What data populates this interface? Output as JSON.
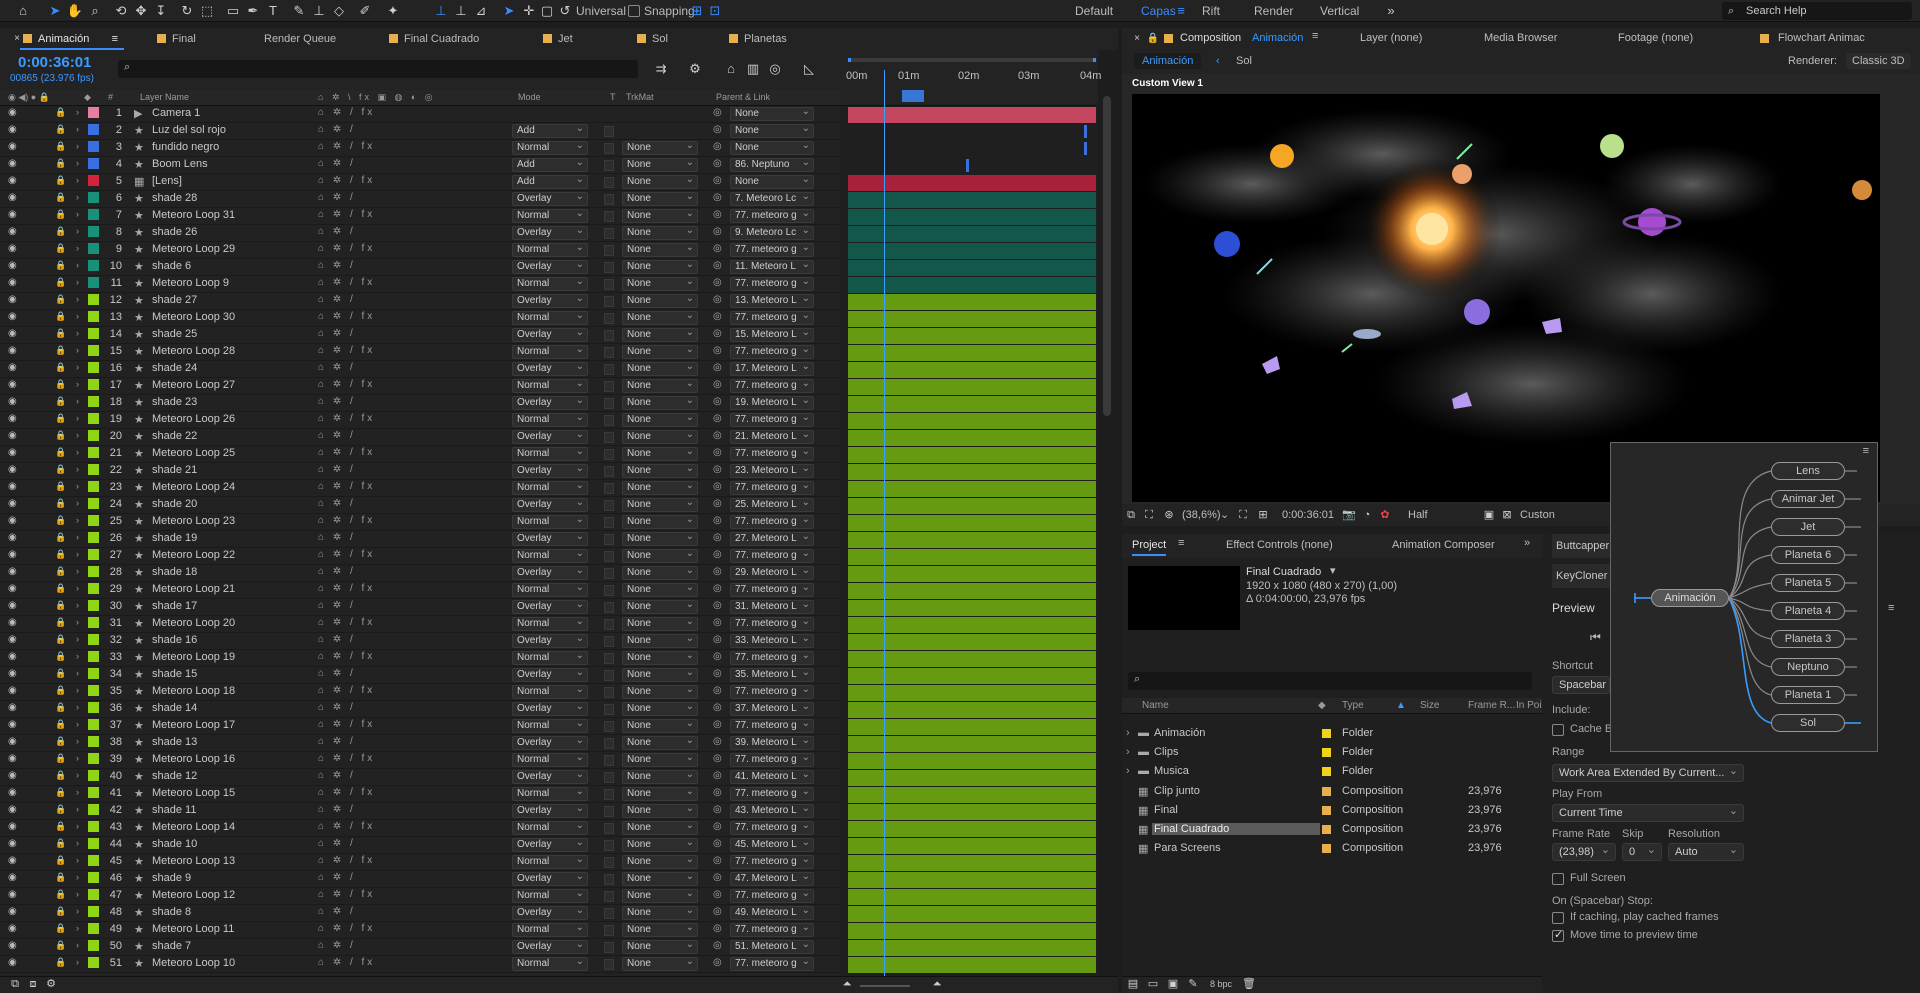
{
  "toolbar": {
    "universal": "Universal",
    "snapping": "Snapping",
    "workspaces": [
      "Default",
      "Capas",
      "Rift",
      "Render",
      "Vertical"
    ],
    "active_workspace": "Capas",
    "search_help": "Search Help"
  },
  "timeline": {
    "tabs": [
      "Animación",
      "Final",
      "Render Queue",
      "Final Cuadrado",
      "Jet",
      "Sol",
      "Planetas"
    ],
    "timecode": "0:00:36:01",
    "frames": "00865 (23.976 fps)",
    "ruler": [
      "00m",
      "01m",
      "02m",
      "03m",
      "04m"
    ],
    "headers": {
      "layer_name": "Layer Name",
      "mode": "Mode",
      "t": "T",
      "trkmat": "TrkMat",
      "parent": "Parent & Link"
    },
    "layers": [
      {
        "n": "1",
        "name": "Camera 1",
        "color": "#e87ea0",
        "mode": "",
        "trk": "",
        "parent": "None",
        "icon": "camera",
        "bar": "#c4475f"
      },
      {
        "n": "2",
        "name": "Luz del sol rojo",
        "color": "#3b6fe0",
        "mode": "Add",
        "trk": "",
        "parent": "None",
        "icon": "star",
        "bar": ""
      },
      {
        "n": "3",
        "name": "fundido negro",
        "color": "#3b6fe0",
        "mode": "Normal",
        "trk": "None",
        "parent": "None",
        "icon": "star",
        "bar": ""
      },
      {
        "n": "4",
        "name": "Boom Lens",
        "color": "#3b6fe0",
        "mode": "Add",
        "trk": "None",
        "parent": "86. Neptuno",
        "icon": "star",
        "bar": ""
      },
      {
        "n": "5",
        "name": "[Lens]",
        "color": "#d3243b",
        "mode": "Add",
        "trk": "None",
        "parent": "None",
        "icon": "comp",
        "bar": "#a8213a"
      },
      {
        "n": "6",
        "name": "shade 28",
        "color": "#17917a",
        "mode": "Overlay",
        "trk": "None",
        "parent": "7. Meteoro Lc",
        "icon": "star",
        "bar": "#12574a"
      },
      {
        "n": "7",
        "name": "Meteoro Loop 31",
        "color": "#17917a",
        "mode": "Normal",
        "trk": "None",
        "parent": "77. meteoro g",
        "icon": "star",
        "bar": "#12574a"
      },
      {
        "n": "8",
        "name": "shade 26",
        "color": "#17917a",
        "mode": "Overlay",
        "trk": "None",
        "parent": "9. Meteoro Lc",
        "icon": "star",
        "bar": "#12574a"
      },
      {
        "n": "9",
        "name": "Meteoro Loop 29",
        "color": "#17917a",
        "mode": "Normal",
        "trk": "None",
        "parent": "77. meteoro g",
        "icon": "star",
        "bar": "#12574a"
      },
      {
        "n": "10",
        "name": "shade 6",
        "color": "#17917a",
        "mode": "Overlay",
        "trk": "None",
        "parent": "11. Meteoro L",
        "icon": "star",
        "bar": "#12574a"
      },
      {
        "n": "11",
        "name": "Meteoro Loop 9",
        "color": "#17917a",
        "mode": "Normal",
        "trk": "None",
        "parent": "77. meteoro g",
        "icon": "star",
        "bar": "#12574a"
      },
      {
        "n": "12",
        "name": "shade 27",
        "color": "#8fd417",
        "mode": "Overlay",
        "trk": "None",
        "parent": "13. Meteoro L",
        "icon": "star",
        "bar": "#669a10"
      },
      {
        "n": "13",
        "name": "Meteoro Loop 30",
        "color": "#8fd417",
        "mode": "Normal",
        "trk": "None",
        "parent": "77. meteoro g",
        "icon": "star",
        "bar": "#669a10"
      },
      {
        "n": "14",
        "name": "shade 25",
        "color": "#8fd417",
        "mode": "Overlay",
        "trk": "None",
        "parent": "15. Meteoro L",
        "icon": "star",
        "bar": "#669a10"
      },
      {
        "n": "15",
        "name": "Meteoro Loop 28",
        "color": "#8fd417",
        "mode": "Normal",
        "trk": "None",
        "parent": "77. meteoro g",
        "icon": "star",
        "bar": "#669a10"
      },
      {
        "n": "16",
        "name": "shade 24",
        "color": "#8fd417",
        "mode": "Overlay",
        "trk": "None",
        "parent": "17. Meteoro L",
        "icon": "star",
        "bar": "#669a10"
      },
      {
        "n": "17",
        "name": "Meteoro Loop 27",
        "color": "#8fd417",
        "mode": "Normal",
        "trk": "None",
        "parent": "77. meteoro g",
        "icon": "star",
        "bar": "#669a10"
      },
      {
        "n": "18",
        "name": "shade 23",
        "color": "#8fd417",
        "mode": "Overlay",
        "trk": "None",
        "parent": "19. Meteoro L",
        "icon": "star",
        "bar": "#669a10"
      },
      {
        "n": "19",
        "name": "Meteoro Loop 26",
        "color": "#8fd417",
        "mode": "Normal",
        "trk": "None",
        "parent": "77. meteoro g",
        "icon": "star",
        "bar": "#669a10"
      },
      {
        "n": "20",
        "name": "shade 22",
        "color": "#8fd417",
        "mode": "Overlay",
        "trk": "None",
        "parent": "21. Meteoro L",
        "icon": "star",
        "bar": "#669a10"
      },
      {
        "n": "21",
        "name": "Meteoro Loop 25",
        "color": "#8fd417",
        "mode": "Normal",
        "trk": "None",
        "parent": "77. meteoro g",
        "icon": "star",
        "bar": "#669a10"
      },
      {
        "n": "22",
        "name": "shade 21",
        "color": "#8fd417",
        "mode": "Overlay",
        "trk": "None",
        "parent": "23. Meteoro L",
        "icon": "star",
        "bar": "#669a10"
      },
      {
        "n": "23",
        "name": "Meteoro Loop 24",
        "color": "#8fd417",
        "mode": "Normal",
        "trk": "None",
        "parent": "77. meteoro g",
        "icon": "star",
        "bar": "#669a10"
      },
      {
        "n": "24",
        "name": "shade 20",
        "color": "#8fd417",
        "mode": "Overlay",
        "trk": "None",
        "parent": "25. Meteoro L",
        "icon": "star",
        "bar": "#669a10"
      },
      {
        "n": "25",
        "name": "Meteoro Loop 23",
        "color": "#8fd417",
        "mode": "Normal",
        "trk": "None",
        "parent": "77. meteoro g",
        "icon": "star",
        "bar": "#669a10"
      },
      {
        "n": "26",
        "name": "shade 19",
        "color": "#8fd417",
        "mode": "Overlay",
        "trk": "None",
        "parent": "27. Meteoro L",
        "icon": "star",
        "bar": "#669a10"
      },
      {
        "n": "27",
        "name": "Meteoro Loop 22",
        "color": "#8fd417",
        "mode": "Normal",
        "trk": "None",
        "parent": "77. meteoro g",
        "icon": "star",
        "bar": "#669a10"
      },
      {
        "n": "28",
        "name": "shade 18",
        "color": "#8fd417",
        "mode": "Overlay",
        "trk": "None",
        "parent": "29. Meteoro L",
        "icon": "star",
        "bar": "#669a10"
      },
      {
        "n": "29",
        "name": "Meteoro Loop 21",
        "color": "#8fd417",
        "mode": "Normal",
        "trk": "None",
        "parent": "77. meteoro g",
        "icon": "star",
        "bar": "#669a10"
      },
      {
        "n": "30",
        "name": "shade 17",
        "color": "#8fd417",
        "mode": "Overlay",
        "trk": "None",
        "parent": "31. Meteoro L",
        "icon": "star",
        "bar": "#669a10"
      },
      {
        "n": "31",
        "name": "Meteoro Loop 20",
        "color": "#8fd417",
        "mode": "Normal",
        "trk": "None",
        "parent": "77. meteoro g",
        "icon": "star",
        "bar": "#669a10"
      },
      {
        "n": "32",
        "name": "shade 16",
        "color": "#8fd417",
        "mode": "Overlay",
        "trk": "None",
        "parent": "33. Meteoro L",
        "icon": "star",
        "bar": "#669a10"
      },
      {
        "n": "33",
        "name": "Meteoro Loop 19",
        "color": "#8fd417",
        "mode": "Normal",
        "trk": "None",
        "parent": "77. meteoro g",
        "icon": "star",
        "bar": "#669a10"
      },
      {
        "n": "34",
        "name": "shade 15",
        "color": "#8fd417",
        "mode": "Overlay",
        "trk": "None",
        "parent": "35. Meteoro L",
        "icon": "star",
        "bar": "#669a10"
      },
      {
        "n": "35",
        "name": "Meteoro Loop 18",
        "color": "#8fd417",
        "mode": "Normal",
        "trk": "None",
        "parent": "77. meteoro g",
        "icon": "star",
        "bar": "#669a10"
      },
      {
        "n": "36",
        "name": "shade 14",
        "color": "#8fd417",
        "mode": "Overlay",
        "trk": "None",
        "parent": "37. Meteoro L",
        "icon": "star",
        "bar": "#669a10"
      },
      {
        "n": "37",
        "name": "Meteoro Loop 17",
        "color": "#8fd417",
        "mode": "Normal",
        "trk": "None",
        "parent": "77. meteoro g",
        "icon": "star",
        "bar": "#669a10"
      },
      {
        "n": "38",
        "name": "shade 13",
        "color": "#8fd417",
        "mode": "Overlay",
        "trk": "None",
        "parent": "39. Meteoro L",
        "icon": "star",
        "bar": "#669a10"
      },
      {
        "n": "39",
        "name": "Meteoro Loop 16",
        "color": "#8fd417",
        "mode": "Normal",
        "trk": "None",
        "parent": "77. meteoro g",
        "icon": "star",
        "bar": "#669a10"
      },
      {
        "n": "40",
        "name": "shade 12",
        "color": "#8fd417",
        "mode": "Overlay",
        "trk": "None",
        "parent": "41. Meteoro L",
        "icon": "star",
        "bar": "#669a10"
      },
      {
        "n": "41",
        "name": "Meteoro Loop 15",
        "color": "#8fd417",
        "mode": "Normal",
        "trk": "None",
        "parent": "77. meteoro g",
        "icon": "star",
        "bar": "#669a10"
      },
      {
        "n": "42",
        "name": "shade 11",
        "color": "#8fd417",
        "mode": "Overlay",
        "trk": "None",
        "parent": "43. Meteoro L",
        "icon": "star",
        "bar": "#669a10"
      },
      {
        "n": "43",
        "name": "Meteoro Loop 14",
        "color": "#8fd417",
        "mode": "Normal",
        "trk": "None",
        "parent": "77. meteoro g",
        "icon": "star",
        "bar": "#669a10"
      },
      {
        "n": "44",
        "name": "shade 10",
        "color": "#8fd417",
        "mode": "Overlay",
        "trk": "None",
        "parent": "45. Meteoro L",
        "icon": "star",
        "bar": "#669a10"
      },
      {
        "n": "45",
        "name": "Meteoro Loop 13",
        "color": "#8fd417",
        "mode": "Normal",
        "trk": "None",
        "parent": "77. meteoro g",
        "icon": "star",
        "bar": "#669a10"
      },
      {
        "n": "46",
        "name": "shade 9",
        "color": "#8fd417",
        "mode": "Overlay",
        "trk": "None",
        "parent": "47. Meteoro L",
        "icon": "star",
        "bar": "#669a10"
      },
      {
        "n": "47",
        "name": "Meteoro Loop 12",
        "color": "#8fd417",
        "mode": "Normal",
        "trk": "None",
        "parent": "77. meteoro g",
        "icon": "star",
        "bar": "#669a10"
      },
      {
        "n": "48",
        "name": "shade 8",
        "color": "#8fd417",
        "mode": "Overlay",
        "trk": "None",
        "parent": "49. Meteoro L",
        "icon": "star",
        "bar": "#669a10"
      },
      {
        "n": "49",
        "name": "Meteoro Loop 11",
        "color": "#8fd417",
        "mode": "Normal",
        "trk": "None",
        "parent": "77. meteoro g",
        "icon": "star",
        "bar": "#669a10"
      },
      {
        "n": "50",
        "name": "shade 7",
        "color": "#8fd417",
        "mode": "Overlay",
        "trk": "None",
        "parent": "51. Meteoro L",
        "icon": "star",
        "bar": "#669a10"
      },
      {
        "n": "51",
        "name": "Meteoro Loop 10",
        "color": "#8fd417",
        "mode": "Normal",
        "trk": "None",
        "parent": "77. meteoro g",
        "icon": "star",
        "bar": "#669a10"
      }
    ],
    "bottom_bpc": ""
  },
  "composition": {
    "panel_title": "Composition",
    "comp_name": "Animación",
    "layer_tab": "Layer (none)",
    "media_browser": "Media Browser",
    "footage_tab": "Footage (none)",
    "flowchart_tab": "Flowchart Animac",
    "breadcrumb": [
      "Animación",
      "Sol"
    ],
    "renderer_label": "Renderer:",
    "renderer_value": "Classic 3D",
    "view_label": "Custom View 1",
    "zoom": "(38,6%)",
    "timecode": "0:00:36:01",
    "resolution": "Half",
    "view_dropdown": "Custon"
  },
  "project": {
    "tabs": [
      "Project",
      "Effect Controls (none)",
      "Animation Composer"
    ],
    "selected_item": "Final Cuadrado",
    "info_size": "1920 x 1080  (480 x 270) (1,00)",
    "info_duration": "Δ 0:04:00:00, 23,976 fps",
    "columns": {
      "name": "Name",
      "type": "Type",
      "size": "Size",
      "fr": "Frame R...",
      "inpoint": "In Poi"
    },
    "items": [
      {
        "name": "Animación",
        "type": "Folder",
        "fr": "",
        "folder": true
      },
      {
        "name": "Clips",
        "type": "Folder",
        "fr": "",
        "folder": true
      },
      {
        "name": "Musica",
        "type": "Folder",
        "fr": "",
        "folder": true
      },
      {
        "name": "Clip junto",
        "type": "Composition",
        "fr": "23,976",
        "folder": false
      },
      {
        "name": "Final",
        "type": "Composition",
        "fr": "23,976",
        "folder": false
      },
      {
        "name": "Final Cuadrado",
        "type": "Composition",
        "fr": "23,976",
        "folder": false,
        "selected": true
      },
      {
        "name": "Para Screens",
        "type": "Composition",
        "fr": "23,976",
        "folder": false
      }
    ],
    "bpc": "8 bpc"
  },
  "right": {
    "buttcapper": "Buttcapper",
    "keycloner": "KeyCloner",
    "preview_title": "Preview",
    "shortcut_label": "Shortcut",
    "shortcut_value": "Spacebar",
    "include_label": "Include:",
    "cache_label": "Cache Be",
    "range_label": "Range",
    "range_value": "Work Area Extended By Current...",
    "play_from_label": "Play From",
    "play_from_value": "Current Time",
    "frame_rate_label": "Frame Rate",
    "skip_label": "Skip",
    "resolution_label": "Resolution",
    "frame_rate_value": "(23,98)",
    "skip_value": "0",
    "resolution_value": "Auto",
    "full_screen": "Full Screen",
    "stop_label": "On (Spacebar) Stop:",
    "if_caching": "If caching, play cached frames",
    "move_time": "Move time to preview time"
  },
  "flowchart": {
    "root": "Animación",
    "nodes": [
      "Lens",
      "Animar Jet",
      "Jet",
      "Planeta 6",
      "Planeta 5",
      "Planeta 4",
      "Planeta 3",
      "Neptuno",
      "Planeta 1",
      "Sol"
    ]
  }
}
